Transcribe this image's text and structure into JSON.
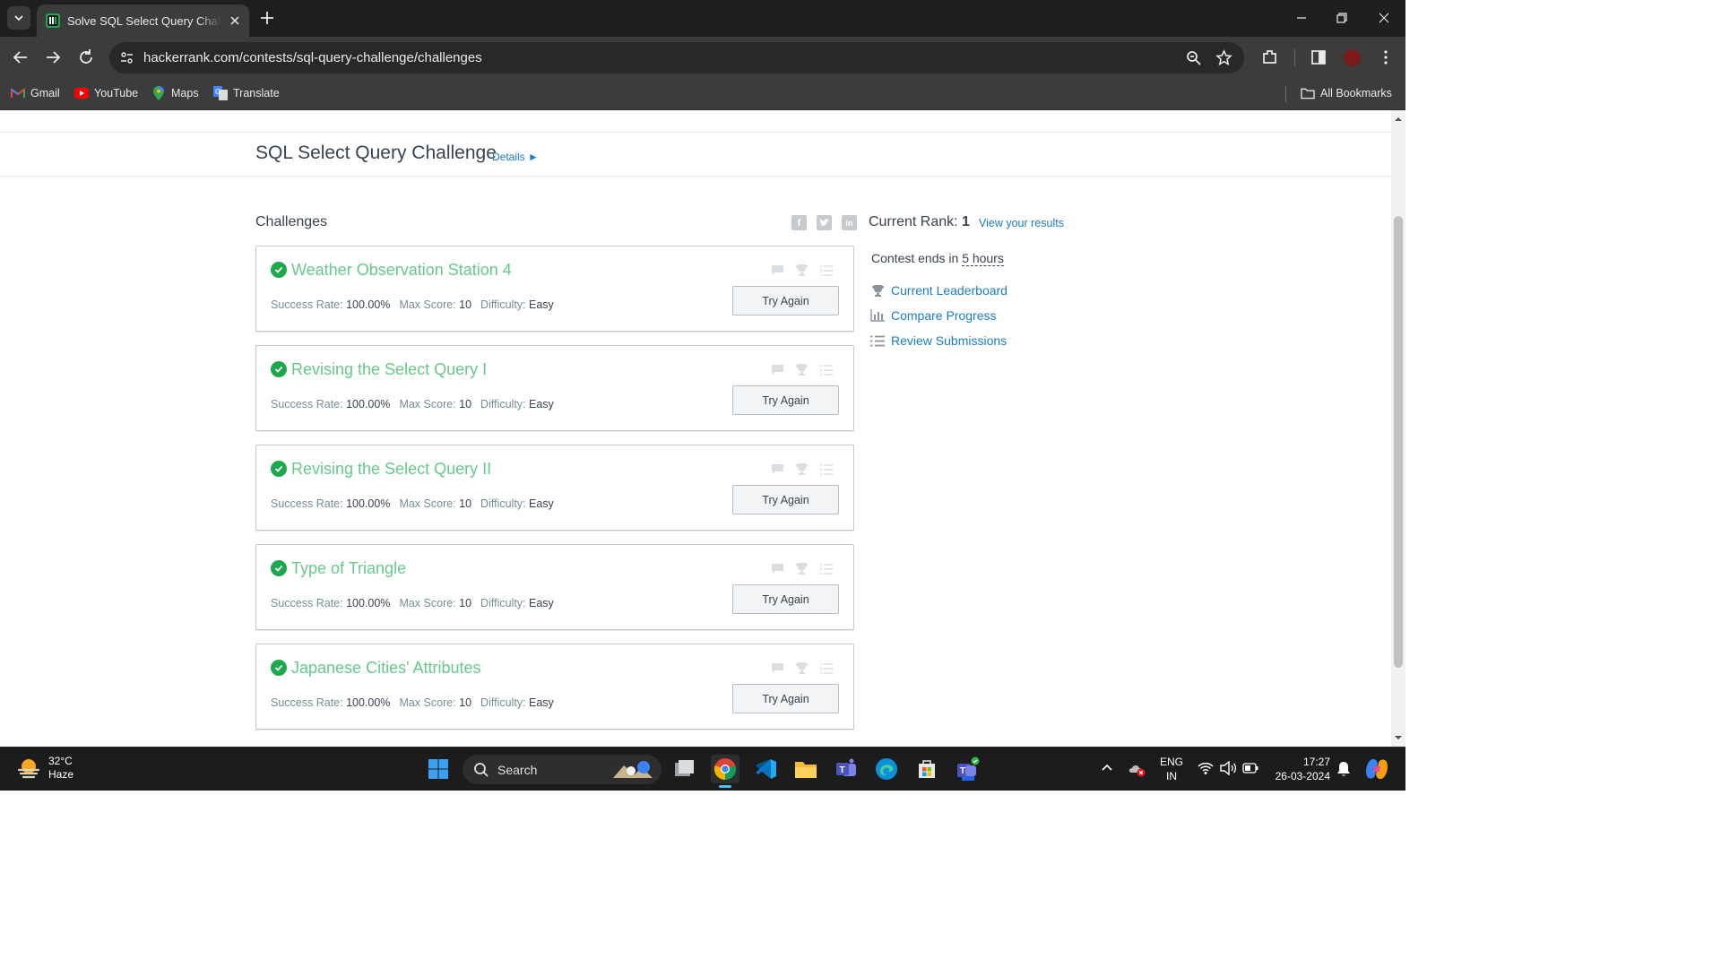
{
  "browser": {
    "tab_title": "Solve SQL Select Query Challenge",
    "url_host": "hackerrank.com",
    "url_path": "/contests/sql-query-challenge/challenges",
    "bookmarks": [
      {
        "label": "Gmail",
        "icon": "gmail-icon"
      },
      {
        "label": "YouTube",
        "icon": "youtube-icon"
      },
      {
        "label": "Maps",
        "icon": "maps-icon"
      },
      {
        "label": "Translate",
        "icon": "translate-icon"
      }
    ],
    "all_bookmarks_label": "All Bookmarks"
  },
  "page": {
    "contest_title": "SQL Select Query Challenge",
    "details_link": "Details ►",
    "section_title": "Challenges",
    "share_icons": [
      "facebook-icon",
      "twitter-icon",
      "linkedin-icon"
    ],
    "rank_label": "Current Rank:",
    "rank_value": "1",
    "view_results": "View your results",
    "contest_ends_prefix": "Contest ends in",
    "contest_ends_value": "5 hours",
    "side_links": [
      {
        "label": "Current Leaderboard",
        "icon": "trophy-icon"
      },
      {
        "label": "Compare Progress",
        "icon": "bar-chart-icon"
      },
      {
        "label": "Review Submissions",
        "icon": "list-icon"
      }
    ],
    "meta_labels": {
      "success": "Success Rate:",
      "max_score": "Max Score:",
      "difficulty": "Difficulty:"
    },
    "challenges": [
      {
        "name": "Weather Observation Station 4",
        "success_rate": "100.00%",
        "max_score": "10",
        "difficulty": "Easy",
        "button": "Try Again"
      },
      {
        "name": "Revising the Select Query I",
        "success_rate": "100.00%",
        "max_score": "10",
        "difficulty": "Easy",
        "button": "Try Again"
      },
      {
        "name": "Revising the Select Query II",
        "success_rate": "100.00%",
        "max_score": "10",
        "difficulty": "Easy",
        "button": "Try Again"
      },
      {
        "name": "Type of Triangle",
        "success_rate": "100.00%",
        "max_score": "10",
        "difficulty": "Easy",
        "button": "Try Again"
      },
      {
        "name": "Japanese Cities' Attributes",
        "success_rate": "100.00%",
        "max_score": "10",
        "difficulty": "Easy",
        "button": "Try Again"
      }
    ]
  },
  "taskbar": {
    "weather_temp": "32°C",
    "weather_desc": "Haze",
    "search_label": "Search",
    "lang_1": "ENG",
    "lang_2": "IN",
    "time": "17:27",
    "date": "26-03-2024"
  },
  "colors": {
    "accent_green": "#1ba94c",
    "challenge_name": "#66c98b",
    "link_blue": "#1a7dc6",
    "text_dark": "#39424e"
  }
}
